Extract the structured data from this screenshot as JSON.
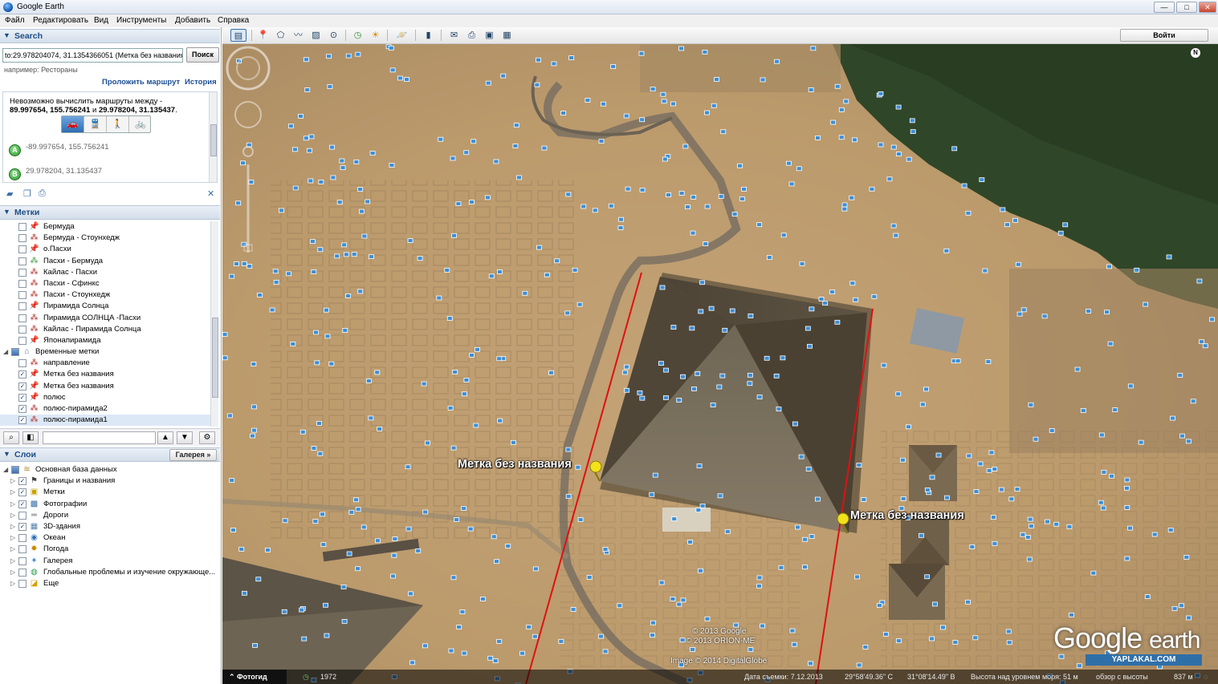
{
  "window": {
    "title": "Google Earth",
    "minimize": "—",
    "maximize": "□",
    "close": "✕"
  },
  "menu": [
    "Файл",
    "Редактировать",
    "Вид",
    "Инструменты",
    "Добавить",
    "Справка"
  ],
  "toolbar": {
    "signin": "Войти"
  },
  "search": {
    "header": "Search",
    "query": "to:29.978204074, 31.1354366051 (Метка без названия)",
    "button": "Поиск",
    "hint": "например: Рестораны",
    "route_link": "Проложить маршрут",
    "history_link": "История",
    "error_line1": "Невозможно вычислить маршруты между -",
    "error_bold1": "89.997654, 155.756241",
    "error_mid": " и ",
    "error_bold2": "29.978204, 31.135437",
    "error_end": ".",
    "point_a_label": "A",
    "point_a": "-89.997654, 155.756241",
    "point_b_label": "B",
    "point_b": "29.978204, 31.135437"
  },
  "places": {
    "header": "Метки",
    "items": [
      {
        "label": "Бермуда",
        "icon": "pushpin-icon"
      },
      {
        "label": "Бермуда - Стоунхедж",
        "icon": "path-icon"
      },
      {
        "label": "о.Пасхи",
        "icon": "pushpin-icon"
      },
      {
        "label": "Пасхи - Бермуда",
        "icon": "path-green-icon"
      },
      {
        "label": "Кайлас - Пасхи",
        "icon": "path-icon"
      },
      {
        "label": "Пасхи - Сфинкс",
        "icon": "path-icon"
      },
      {
        "label": "Пасхи - Стоунхедж",
        "icon": "path-icon"
      },
      {
        "label": "Пирамида Солнца",
        "icon": "pushpin-icon"
      },
      {
        "label": "Пирамида СОЛНЦА -Пасхи",
        "icon": "path-icon"
      },
      {
        "label": "Кайлас - Пирамида Солнца",
        "icon": "path-icon"
      },
      {
        "label": "Японапирамида",
        "icon": "pushpin-icon"
      }
    ],
    "temp_folder": "Временные метки",
    "temp_items": [
      {
        "label": "направление",
        "icon": "path-icon",
        "checked": false
      },
      {
        "label": "Метка без названия",
        "icon": "pushpin-icon",
        "checked": true
      },
      {
        "label": "Метка без названия",
        "icon": "pushpin-icon",
        "checked": true
      },
      {
        "label": "полюс",
        "icon": "pushpin-icon",
        "checked": true
      },
      {
        "label": "полюс-пирамида2",
        "icon": "path-icon",
        "checked": true
      },
      {
        "label": "полюс-пирамида1",
        "icon": "path-icon",
        "checked": true
      }
    ]
  },
  "layers": {
    "header": "Слои",
    "gallery_button": "Галерея  »",
    "root": "Основная база данных",
    "items": [
      {
        "label": "Границы и названия",
        "icon": "borders-icon",
        "checked": true
      },
      {
        "label": "Метки",
        "icon": "labels-icon",
        "checked": true
      },
      {
        "label": "Фотографии",
        "icon": "photo-icon",
        "checked": true
      },
      {
        "label": "Дороги",
        "icon": "roads-icon",
        "checked": false
      },
      {
        "label": "3D-здания",
        "icon": "buildings-icon",
        "checked": true
      },
      {
        "label": "Океан",
        "icon": "ocean-icon",
        "checked": false
      },
      {
        "label": "Погода",
        "icon": "weather-icon",
        "checked": false
      },
      {
        "label": "Галерея",
        "icon": "gallery-icon",
        "checked": false
      },
      {
        "label": "Глобальные проблемы и изучение окружающе...",
        "icon": "globe-icon",
        "checked": false
      },
      {
        "label": "Еще",
        "icon": "more-icon",
        "checked": false
      }
    ]
  },
  "map": {
    "placemark1": "Метка без названия",
    "placemark2": "Метка без названия",
    "credit1": "© 2013 Google",
    "credit2": "© 2013 ORION-ME",
    "credit3": "Image © 2014 DigitalGlobe",
    "logo_google": "Google",
    "logo_earth": "earth",
    "watermark": "YAPLAKAL.COM",
    "north": "N"
  },
  "status": {
    "photo_tour": "Фотогид",
    "year": "1972",
    "date": "Дата съемки: 7.12.2013",
    "lat": "29°58'49.36\" С",
    "lon": "31°08'14.49\" В",
    "elevation": "Высота над уровнем моря:  51 м",
    "eye_alt": "обзор с высоты",
    "eye_val": "837 м"
  }
}
